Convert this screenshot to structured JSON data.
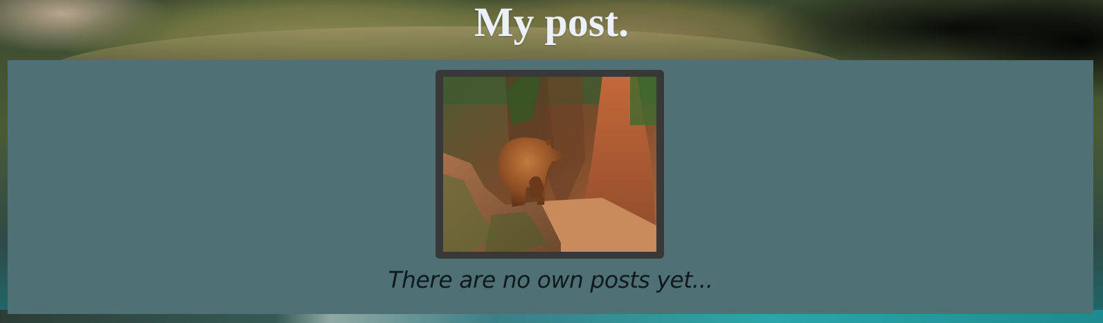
{
  "header": {
    "title": "My post."
  },
  "feed": {
    "empty_message": "There are no own posts yet..."
  },
  "colors": {
    "panel_background": "#4f7075",
    "title_text": "#ecf0fb",
    "message_text": "#101a1c",
    "frame": "#383838"
  },
  "icons": {
    "hero_image": "brown-bear-on-cliff-illustration"
  }
}
